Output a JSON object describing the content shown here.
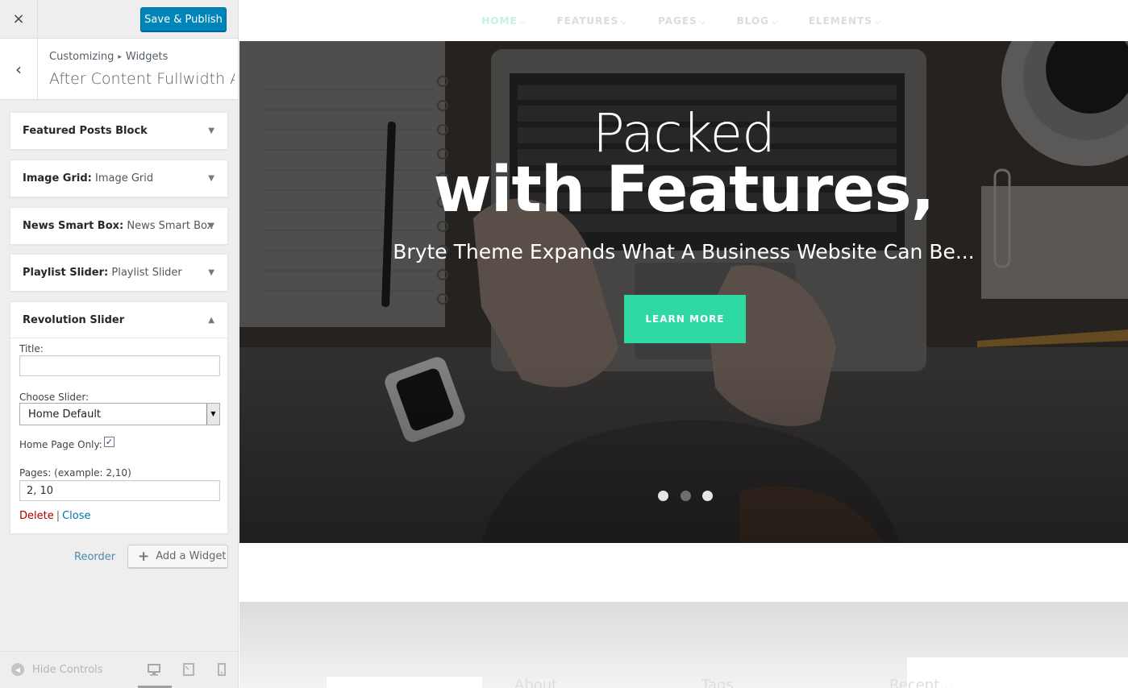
{
  "customizer": {
    "close_icon": "×",
    "save_label": "Save & Publish",
    "back_icon": "‹",
    "breadcrumb": {
      "root": "Customizing",
      "separator": "▸",
      "section": "Widgets"
    },
    "section_title": "After Content Fullwidth A...",
    "widgets": [
      {
        "title": "Featured Posts Block",
        "subtitle": "",
        "arrow": "▼"
      },
      {
        "title": "Image Grid:",
        "subtitle": " Image Grid",
        "arrow": "▼"
      },
      {
        "title": "News Smart Box:",
        "subtitle": " News Smart Box",
        "arrow": "▼"
      },
      {
        "title": "Playlist Slider:",
        "subtitle": " Playlist Slider",
        "arrow": "▼"
      },
      {
        "title": "Revolution Slider",
        "subtitle": "",
        "arrow": "▲"
      }
    ],
    "form": {
      "title_label": "Title:",
      "title_value": "",
      "slider_label": "Choose Slider:",
      "slider_value": "Home Default",
      "home_only_label": "Home Page Only:",
      "home_only_checked": true,
      "home_only_mark": "✓",
      "pages_label": "Pages: (example: 2,10)",
      "pages_value": "2, 10",
      "delete_label": "Delete",
      "separator": "|",
      "close_label": "Close"
    },
    "reorder_label": "Reorder",
    "add_widget_label": "Add a Widget",
    "add_widget_icon": "+",
    "hide_controls_label": "Hide Controls",
    "hide_controls_icon": "◀"
  },
  "site": {
    "nav": [
      {
        "label": "HOME",
        "active": true
      },
      {
        "label": "FEATURES",
        "active": false
      },
      {
        "label": "PAGES",
        "active": false
      },
      {
        "label": "BLOG",
        "active": false
      },
      {
        "label": "ELEMENTS",
        "active": false
      }
    ],
    "nav_chevron": "⌵",
    "hero": {
      "line1": "Packed",
      "line2": "with Features,",
      "subtitle": "Bryte Theme Expands What A Business Website Can Be...",
      "cta_label": "LEARN MORE",
      "slide_count": 3,
      "active_slide": 2
    },
    "footer_headings": [
      "About",
      "Tags",
      "Recent..."
    ]
  },
  "colors": {
    "save_button": "#0085ba",
    "cta": "#2ed8a3",
    "nav_active": "#c4f2df",
    "delete": "#aa0000",
    "link": "#0073aa"
  }
}
